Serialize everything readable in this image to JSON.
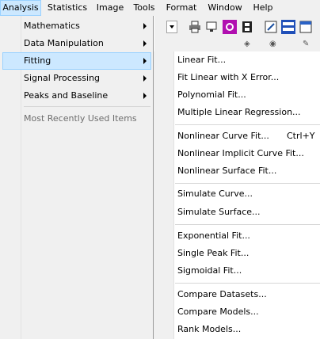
{
  "menubar": {
    "items": [
      "Analysis",
      "Statistics",
      "Image",
      "Tools",
      "Format",
      "Window",
      "Help"
    ]
  },
  "analysis_menu": {
    "items": [
      {
        "label": "Mathematics",
        "has_submenu": true
      },
      {
        "label": "Data Manipulation",
        "has_submenu": true
      },
      {
        "label": "Fitting",
        "has_submenu": true,
        "highlighted": true
      },
      {
        "label": "Signal Processing",
        "has_submenu": true
      },
      {
        "label": "Peaks and Baseline",
        "has_submenu": true
      },
      {
        "label": "Most Recently Used Items",
        "disabled": true
      }
    ]
  },
  "fitting_menu": {
    "groups": [
      [
        {
          "label": "Linear Fit..."
        },
        {
          "label": "Fit Linear with X Error..."
        },
        {
          "label": "Polynomial Fit..."
        },
        {
          "label": "Multiple Linear Regression..."
        }
      ],
      [
        {
          "label": "Nonlinear Curve Fit...",
          "shortcut": "Ctrl+Y"
        },
        {
          "label": "Nonlinear Implicit Curve Fit..."
        },
        {
          "label": "Nonlinear Surface Fit..."
        }
      ],
      [
        {
          "label": "Simulate Curve..."
        },
        {
          "label": "Simulate Surface..."
        }
      ],
      [
        {
          "label": "Exponential Fit..."
        },
        {
          "label": "Single Peak Fit..."
        },
        {
          "label": "Sigmoidal Fit..."
        }
      ],
      [
        {
          "label": "Compare Datasets..."
        },
        {
          "label": "Compare Models..."
        },
        {
          "label": "Rank Models..."
        }
      ]
    ]
  },
  "colors": {
    "highlight_bg": "#cce8ff",
    "highlight_border": "#99d1ff",
    "menu_bg": "#f0f0f0"
  }
}
